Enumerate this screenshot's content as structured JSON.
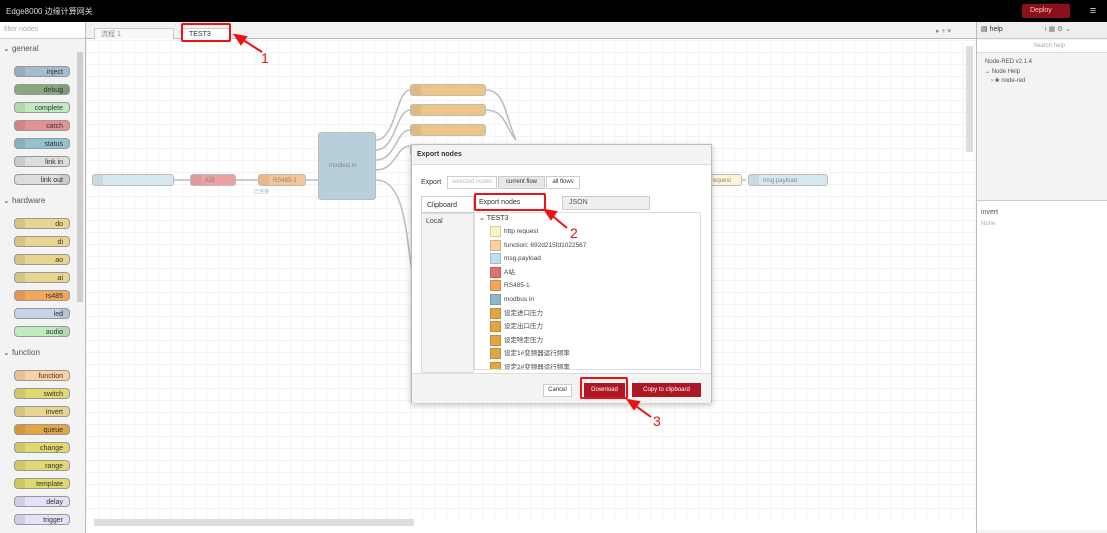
{
  "header": {
    "title": "Edge8000 边缘计算网关",
    "deploy_label": "Deploy",
    "menu_icon": "hamburger-icon"
  },
  "palette": {
    "search_placeholder": "filter nodes",
    "categories": {
      "general": {
        "title": "general",
        "nodes": [
          "inject",
          "debug",
          "complete",
          "catch",
          "status",
          "link in",
          "link out"
        ]
      },
      "hardware": {
        "title": "hardware",
        "nodes": [
          "do",
          "di",
          "ao",
          "ai",
          "rs485",
          "led",
          "audio"
        ]
      },
      "function": {
        "title": "function",
        "nodes": [
          "function",
          "switch",
          "invert",
          "queue",
          "change",
          "range",
          "template",
          "delay",
          "trigger"
        ]
      }
    }
  },
  "workspace": {
    "tabs": [
      "流程 1",
      "TEST3"
    ],
    "flow_nodes": {
      "a": "A站",
      "rs485": "RS485-1",
      "rs485_status": "已连接",
      "modbus": "modbus in",
      "request": "request",
      "payload": "msg.payload"
    }
  },
  "annotations": [
    "1",
    "2",
    "3"
  ],
  "dialog": {
    "title": "Export nodes",
    "export_label": "Export",
    "scope_options": [
      "selected nodes",
      "current flow",
      "all flows"
    ],
    "side_tabs": [
      "Clipboard",
      "Local"
    ],
    "content_tabs": [
      "Export nodes",
      "JSON"
    ],
    "tree_root": "TEST3",
    "tree_items": [
      {
        "label": "http request",
        "color": "#fdf0c2"
      },
      {
        "label": "function: 692d215fd1022567",
        "color": "#fdd0a2"
      },
      {
        "label": "msg.payload",
        "color": "#c0deed"
      },
      {
        "label": "A站",
        "color": "#e2716c"
      },
      {
        "label": "RS485-1",
        "color": "#f3a55a"
      },
      {
        "label": "modbus in",
        "color": "#8fb5c8"
      },
      {
        "label": "设定进口压力",
        "color": "#e2a544"
      },
      {
        "label": "设定出口压力",
        "color": "#e2a544"
      },
      {
        "label": "设定啥定压力",
        "color": "#e2a544"
      },
      {
        "label": "设定1#变频器运行频率",
        "color": "#e2a544"
      },
      {
        "label": "设定2#变频器运行频率",
        "color": "#e2a544"
      }
    ],
    "buttons": {
      "cancel": "Cancel",
      "download": "Download",
      "copy": "Copy to clipboard"
    }
  },
  "sidebar": {
    "tab_label": "help",
    "search_placeholder": "Search help",
    "version": "Node-RED v2.1.4",
    "node_help": "Node Help",
    "node_red_item": "node-red",
    "invert_title": "invert",
    "invert_desc": "None"
  },
  "colors": {
    "accent_red": "#ad1625",
    "annotation_red": "#ee1111",
    "header_bg": "#000000"
  }
}
